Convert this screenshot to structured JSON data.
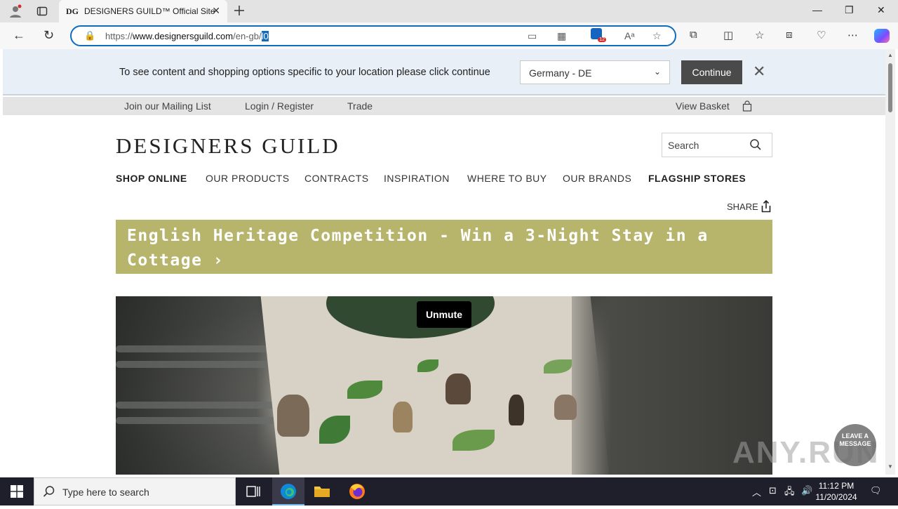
{
  "browser": {
    "tab_favicon": "DG",
    "tab_title": "DESIGNERS GUILD™ Official Site",
    "url_prefix": "https://",
    "url_host": "www.designersguild.com",
    "url_path": "/en-gb/",
    "url_selected": "l0",
    "new_tab_icon": "plus-icon",
    "accent_color": "#0f6cbd",
    "extension_badge": "12"
  },
  "location_banner": {
    "message": "To see content and shopping options specific to your location please click continue",
    "selected_country": "Germany - DE",
    "continue_label": "Continue"
  },
  "utility_bar": {
    "mailing_list": "Join our Mailing List",
    "login": "Login / Register",
    "trade": "Trade",
    "basket": "View Basket"
  },
  "header": {
    "logo": "DESIGNERS GUILD",
    "search_placeholder": "Search"
  },
  "main_nav": {
    "items": [
      {
        "label": "SHOP ONLINE"
      },
      {
        "label": "OUR PRODUCTS"
      },
      {
        "label": "CONTRACTS"
      },
      {
        "label": "INSPIRATION"
      },
      {
        "label": "WHERE TO BUY"
      },
      {
        "label": "OUR BRANDS"
      },
      {
        "label": "FLAGSHIP STORES"
      }
    ]
  },
  "share_label": "SHARE",
  "promo": {
    "text": "English Heritage Competition - Win a 3-Night Stay in a Cottage ›",
    "color": "#b7b46b"
  },
  "video": {
    "unmute_label": "Unmute"
  },
  "chat_widget": {
    "line1": "LEAVE A",
    "line2": "MESSAGE"
  },
  "watermark": "ANY.RUN",
  "taskbar": {
    "search_placeholder": "Type here to search",
    "time": "11:12 PM",
    "date": "11/20/2024"
  }
}
